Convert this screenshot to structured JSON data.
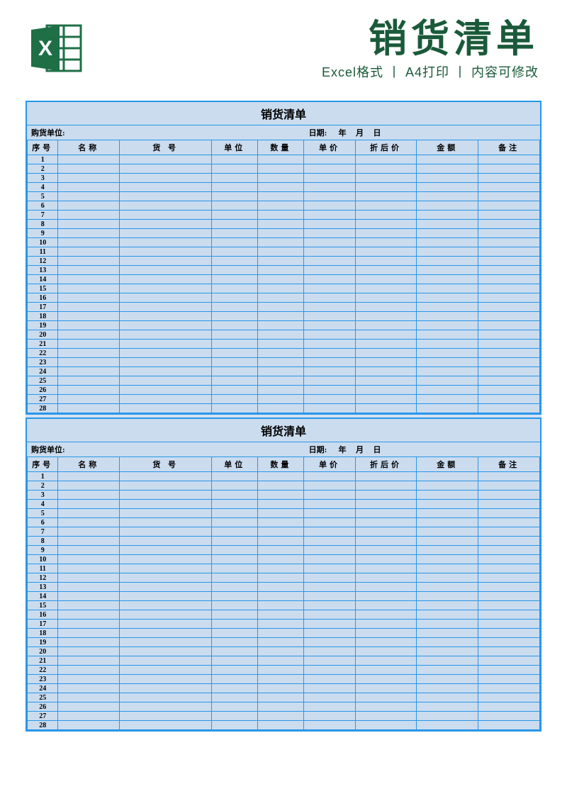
{
  "header": {
    "main_title": "销货清单",
    "tag1": "Excel格式",
    "tag2": "A4打印",
    "tag3": "内容可修改",
    "separator": "丨"
  },
  "list": {
    "title": "销货清单",
    "buyer_label": "购货单位:",
    "date_label": "日期:",
    "year": "年",
    "month": "月",
    "day": "日",
    "columns": {
      "seq": "序号",
      "name": "名称",
      "code": "货  号",
      "unit": "单位",
      "qty": "数量",
      "price": "单价",
      "disc": "折后价",
      "amt": "金额",
      "note": "备注"
    },
    "row_count": 28
  }
}
